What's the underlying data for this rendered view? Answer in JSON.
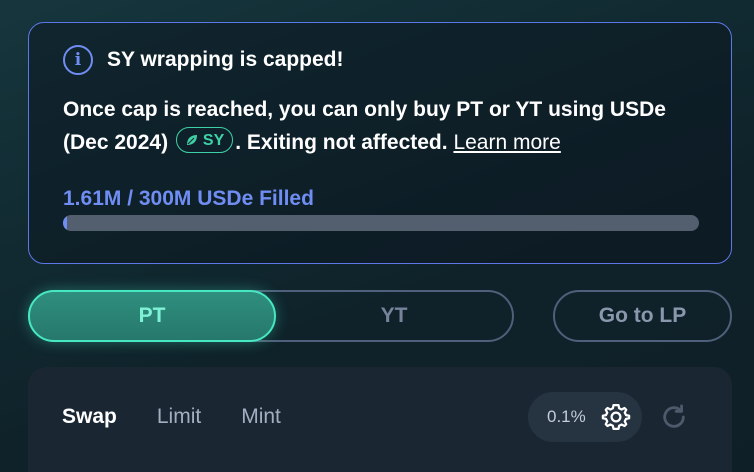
{
  "notice": {
    "title": "SY wrapping is capped!",
    "body_part1": "Once cap is reached, you can only buy PT or YT using USDe (Dec 2024)",
    "sy_chip_label": "SY",
    "body_part2": ". Exiting not affected.",
    "learn_more": "Learn more",
    "fill_label": "1.61M / 300M USDe Filled",
    "filled_amount": 1.61,
    "cap_amount": 300,
    "fill_fraction": 0.0054,
    "accent_color": "#6f8df2",
    "icon": "info-icon"
  },
  "mode_toggle": {
    "options": [
      "PT",
      "YT"
    ],
    "selected": "PT",
    "active_color": "#45e8c1"
  },
  "lp_button": {
    "label": "Go to LP"
  },
  "panel": {
    "tabs": [
      "Swap",
      "Limit",
      "Mint"
    ],
    "active_tab": "Swap",
    "slippage": "0.1%",
    "settings_icon": "gear-icon",
    "refresh_icon": "refresh-icon"
  }
}
